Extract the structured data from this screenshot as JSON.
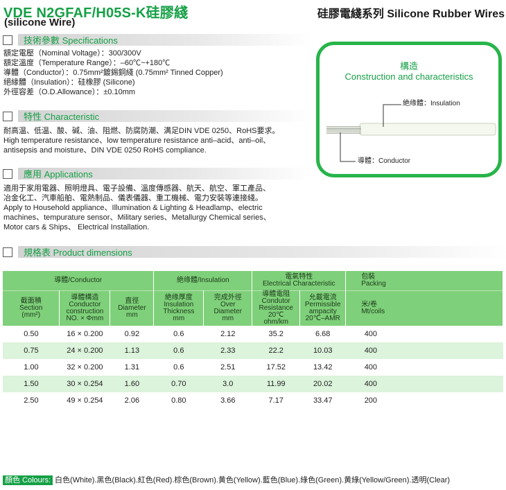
{
  "header": {
    "title": "VDE N2GFAF/H05S-K硅膠綫",
    "subtitle": "(silicone Wire)",
    "series": "硅膠電綫系列 Silicone Rubber Wires"
  },
  "specifications": {
    "heading": "技術參數 Specifications",
    "lines": [
      "額定電壓（Nominal Voltage）：300/300V",
      "額定溫度（Temperature Range）：–60℃~+180℃",
      "導體（Conductor）：0.75mm²鍍錫銅綫 (0.75mm² Tinned Copper)",
      "絕緣體（Insulation）：硅橡膠 (Silicone)",
      "外徑容差（O.D.Allowance）：±0.10mm"
    ]
  },
  "characteristic": {
    "heading": "特性 Characteristic",
    "lines": [
      "耐高温、低温、酸、碱、油、阻燃、防腐防潮、满足DIN VDE 0250、RoHS要求。",
      "High temperature resistance、low temperature resistance anti–acid、anti–oil、",
      "antisepsis and moisture、DIN VDE 0250 RoHS compliance."
    ]
  },
  "applications": {
    "heading": "應用 Applications",
    "lines": [
      "適用于家用電器、照明燈具、電子設備、溫度傳感器、航天、航空、軍工產品、",
      "冶金化工、汽車船舶、電熱制品、儀表儀器、重工機械、電力安裝等連接綫。",
      "Apply to Household appliance、Illumination & Lighting & Headlamp、electric",
      "machines、tempurature sensor、Military series、Metallurgy Chemical series、",
      "Motor cars & Ships、 Electrical Installation."
    ]
  },
  "construction": {
    "title_cn": "構造",
    "title_en": "Construction and characteristics",
    "insulation_label": "絶缘體：Insulation",
    "conductor_label": "導體：Conductor",
    "colors": {
      "frame": "#28b44a",
      "cable": "#f4f8ee",
      "strands": "#bfc7b8",
      "leader": "#333333"
    }
  },
  "dimensions": {
    "heading": "規格表 Product dimensions",
    "group_headers": [
      {
        "lines": [
          "導體/Conductor"
        ]
      },
      {
        "lines": [
          "絶缘體/Insulation"
        ]
      },
      {
        "lines": [
          "電氣特性",
          "Electrical Characteristic"
        ]
      },
      {
        "lines": [
          "包裝",
          "Packing"
        ]
      }
    ],
    "sub_headers": [
      {
        "lines": [
          "截面積",
          "Section",
          "(mm²)"
        ]
      },
      {
        "lines": [
          "導體構造",
          "Conductor",
          "construction",
          "NO. × Φmm"
        ]
      },
      {
        "lines": [
          "直徑",
          "Diameter",
          "mm"
        ]
      },
      {
        "lines": [
          "絶缘厚度",
          "Insulation",
          "Thickness",
          "mm"
        ]
      },
      {
        "lines": [
          "完成外徑",
          "Over",
          "Diameter",
          "mm"
        ]
      },
      {
        "lines": [
          "導體電阻",
          "Condutor",
          "Resistance 20℃",
          "ohm/km"
        ]
      },
      {
        "lines": [
          "允載電流",
          "Permissible",
          "ampacity",
          "20℃–AMR"
        ]
      },
      {
        "lines": [
          "米/卷",
          "Mt/coils"
        ]
      }
    ],
    "rows": [
      [
        "0.50",
        "16 × 0.200",
        "0.92",
        "0.6",
        "2.12",
        "35.2",
        "6.68",
        "400"
      ],
      [
        "0.75",
        "24 × 0.200",
        "1.13",
        "0.6",
        "2.33",
        "22.2",
        "10.03",
        "400"
      ],
      [
        "1.00",
        "32 × 0.200",
        "1.31",
        "0.6",
        "2.51",
        "17.52",
        "13.42",
        "400"
      ],
      [
        "1.50",
        "30 × 0.254",
        "1.60",
        "0.70",
        "3.0",
        "11.99",
        "20.02",
        "400"
      ],
      [
        "2.50",
        "49 × 0.254",
        "2.06",
        "0.80",
        "3.66",
        "7.17",
        "33.47",
        "200"
      ]
    ]
  },
  "colours": {
    "label": "顏色 Colours:",
    "list": "白色(White).黑色(Black).紅色(Red).棕色(Brown).黄色(Yellow).藍色(Blue).綠色(Green).黄綠(Yellow/Green).透明(Clear)"
  }
}
